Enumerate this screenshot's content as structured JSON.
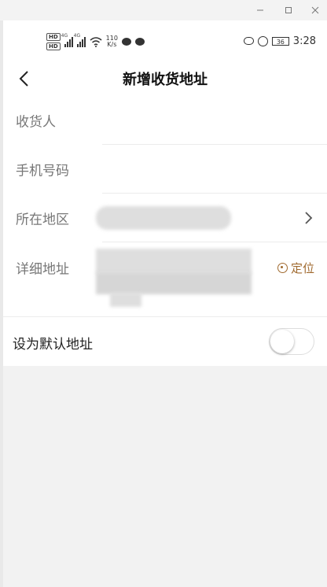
{
  "window": {
    "minimize_icon": "minimize-icon",
    "maximize_icon": "maximize-icon",
    "close_icon": "close-icon"
  },
  "status_bar": {
    "hd_labels": [
      "HD",
      "HD"
    ],
    "network_tags": [
      "4G",
      "4G"
    ],
    "net_speed_value": "110",
    "net_speed_unit": "K/s",
    "battery": "36",
    "time": "3:28"
  },
  "header": {
    "title": "新增收货地址",
    "back_icon": "chevron-left-icon"
  },
  "form": {
    "receiver_label": "收货人",
    "phone_label": "手机号码",
    "region_label": "所在地区",
    "address_label": "详细地址",
    "locate_label": "定位",
    "locate_color": "#a06a2f"
  },
  "default_address": {
    "label": "设为默认地址",
    "enabled": false
  }
}
